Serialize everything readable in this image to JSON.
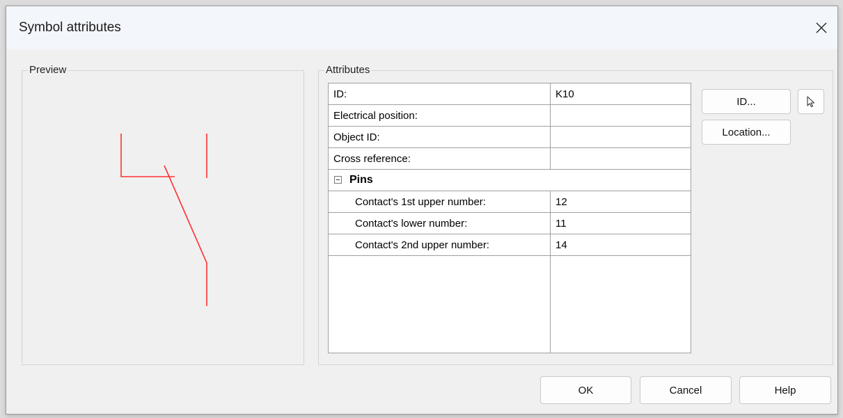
{
  "window": {
    "title": "Symbol attributes"
  },
  "preview": {
    "label": "Preview",
    "symbol_color": "#ff3030"
  },
  "attributes": {
    "label": "Attributes",
    "rows": [
      {
        "name": "ID:",
        "value": "K10"
      },
      {
        "name": "Electrical position:",
        "value": ""
      },
      {
        "name": "Object ID:",
        "value": ""
      },
      {
        "name": "Cross reference:",
        "value": ""
      }
    ],
    "category": {
      "name": "Pins",
      "expander_icon": "minus-box-icon"
    },
    "pins": [
      {
        "name": "Contact's 1st upper number:",
        "value": "12"
      },
      {
        "name": "Contact's lower number:",
        "value": "11"
      },
      {
        "name": "Contact's 2nd upper number:",
        "value": "14"
      }
    ]
  },
  "side_buttons": {
    "id_label": "ID...",
    "location_label": "Location...",
    "pick_icon": "cursor-arrow-icon"
  },
  "footer": {
    "ok_label": "OK",
    "cancel_label": "Cancel",
    "help_label": "Help"
  }
}
